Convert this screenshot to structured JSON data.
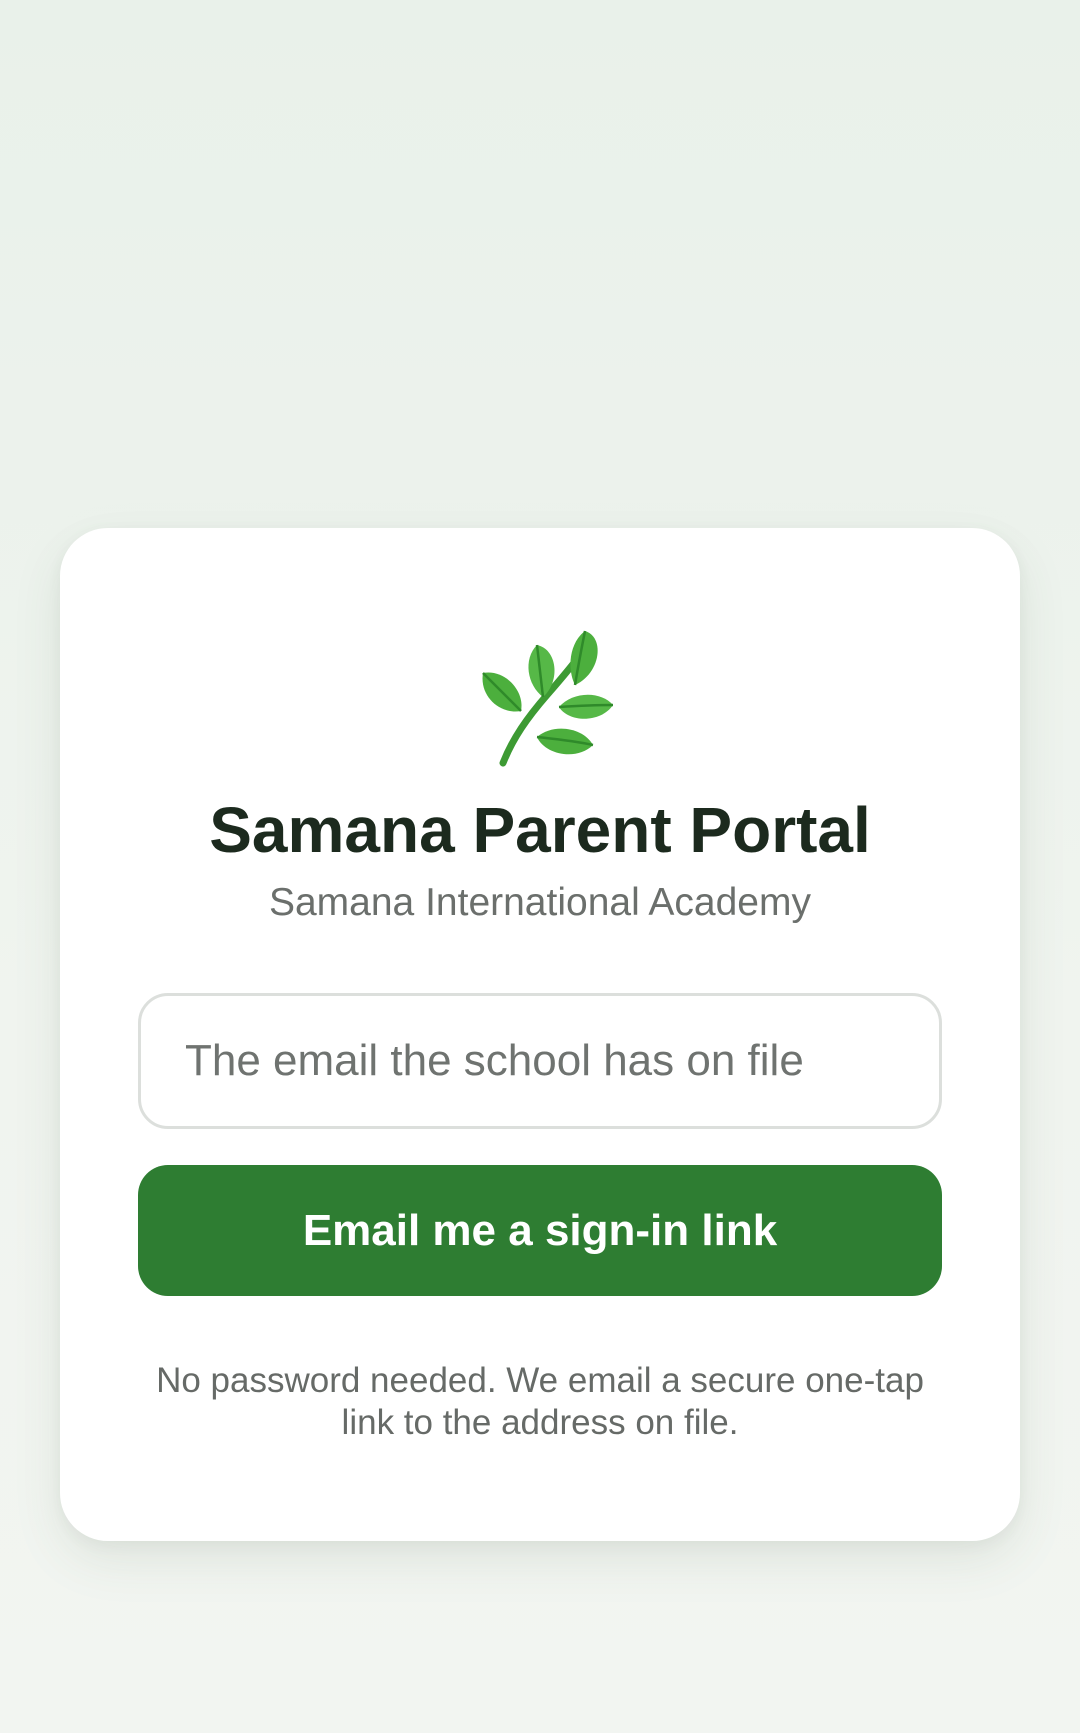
{
  "logo": {
    "icon": "herb-leaf-icon",
    "colors": {
      "leaf": "#4caf3d",
      "leaf_dark": "#2f8a2a",
      "stem": "#3d9a33"
    }
  },
  "header": {
    "title": "Samana Parent Portal",
    "subtitle": "Samana International Academy"
  },
  "form": {
    "email_placeholder": "The email the school has on file",
    "email_value": "",
    "submit_label": "Email me a sign-in link"
  },
  "footer": {
    "hint_line1": "No password needed. We email a secure one-tap",
    "hint_line2": "link to the address on file."
  },
  "theme": {
    "accent": "#2e7d32",
    "background": "#eef3ee",
    "card": "#ffffff"
  }
}
